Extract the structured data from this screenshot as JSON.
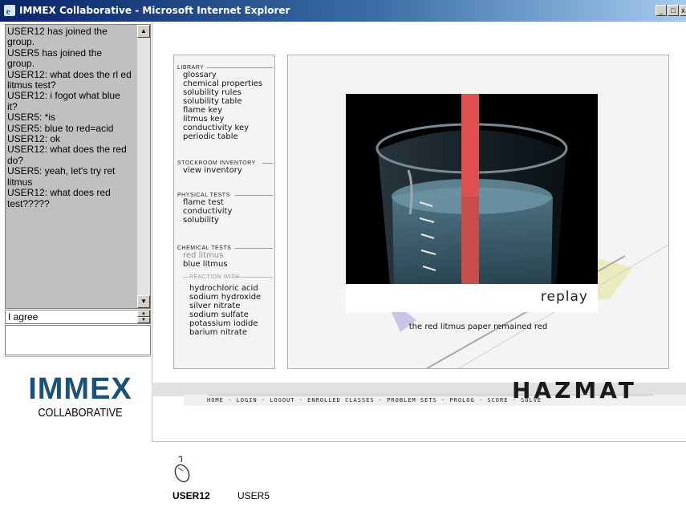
{
  "window": {
    "title": "IMMEX Collaborative - Microsoft Internet Explorer",
    "controls": [
      "minimize",
      "maximize",
      "close"
    ]
  },
  "chat": {
    "messages": [
      "USER12 has joined the",
      "group.",
      "USER5 has joined the",
      "group.",
      "USER12: what does the rl ed",
      "litmus test?",
      "USER12: i fogot what blue",
      "it?",
      "USER5: *is",
      "USER5: blue to red=acid",
      "USER12: ok",
      "USER12: what does the red",
      "do?",
      "USER5: yeah, let's try ret",
      "litmus",
      "USER12: what does red",
      "test?????"
    ],
    "input_value": "I agree",
    "compose_value": ""
  },
  "logo": {
    "name": "IMMEX",
    "subtitle": "COLLABORATIVE"
  },
  "library": {
    "sections": [
      {
        "title": "LIBRARY",
        "items": [
          "glossary",
          "chemical properties",
          "solubility rules",
          "solubility table",
          "flame key",
          "litmus key",
          "conductivity key",
          "periodic table"
        ]
      },
      {
        "title": "STOCKROOM INVENTORY",
        "items": [
          "view inventory"
        ]
      },
      {
        "title": "PHYSICAL TESTS",
        "items": [
          "flame test",
          "conductivity",
          "solubility"
        ]
      },
      {
        "title": "CHEMICAL TESTS",
        "items": [
          "red litmus",
          "blue litmus"
        ]
      },
      {
        "title": "REACTION WITH",
        "items": [
          "hydrochloric acid",
          "sodium hydroxide",
          "silver nitrate",
          "sodium sulfate",
          "potassium iodide",
          "barium nitrate"
        ]
      }
    ]
  },
  "stage": {
    "replay_label": "replay",
    "result_text": "the red litmus paper remained red"
  },
  "brand": {
    "title": "HAZMAT",
    "nav": "HOME · LOGIN · LOGOUT · ENROLLED CLASSES · PROBLEM SETS · PROLOG · SCORE · SOLVE"
  },
  "users": {
    "active": "USER12",
    "other": "USER5"
  },
  "colors": {
    "titlebar_start": "#0a246a",
    "chat_bg": "#c0c0c0",
    "logo_blue": "#1b5378",
    "litmus_red": "#e05050"
  }
}
